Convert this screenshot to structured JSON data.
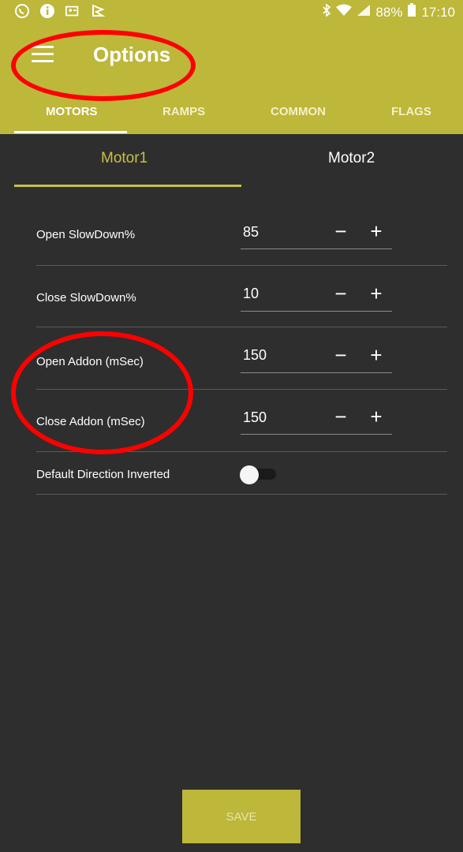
{
  "status_bar": {
    "battery": "88%",
    "time": "17:10"
  },
  "app_bar": {
    "title": "Options"
  },
  "tabs": [
    {
      "label": "MOTORS"
    },
    {
      "label": "RAMPS"
    },
    {
      "label": "COMMON"
    },
    {
      "label": "FLAGS"
    }
  ],
  "subtabs": [
    {
      "label": "Motor1"
    },
    {
      "label": "Motor2"
    }
  ],
  "settings": [
    {
      "label": "Open SlowDown%",
      "value": "85"
    },
    {
      "label": "Close SlowDown%",
      "value": "10"
    },
    {
      "label": "Open Addon (mSec)",
      "value": "150"
    },
    {
      "label": "Close Addon (mSec)",
      "value": "150"
    }
  ],
  "stepper": {
    "minus": "−",
    "plus": "+"
  },
  "toggle_setting": {
    "label": "Default Direction Inverted",
    "value": false
  },
  "save_button": {
    "label": "SAVE"
  },
  "colors": {
    "accent": "#bdb73a",
    "background": "#2e2e2e",
    "annotation": "#ff0000"
  },
  "icons": [
    "whatsapp-icon",
    "info-icon",
    "contact-card-icon",
    "flag-icon",
    "bluetooth-icon",
    "wifi-icon",
    "signal-icon",
    "battery-icon",
    "menu-icon"
  ]
}
